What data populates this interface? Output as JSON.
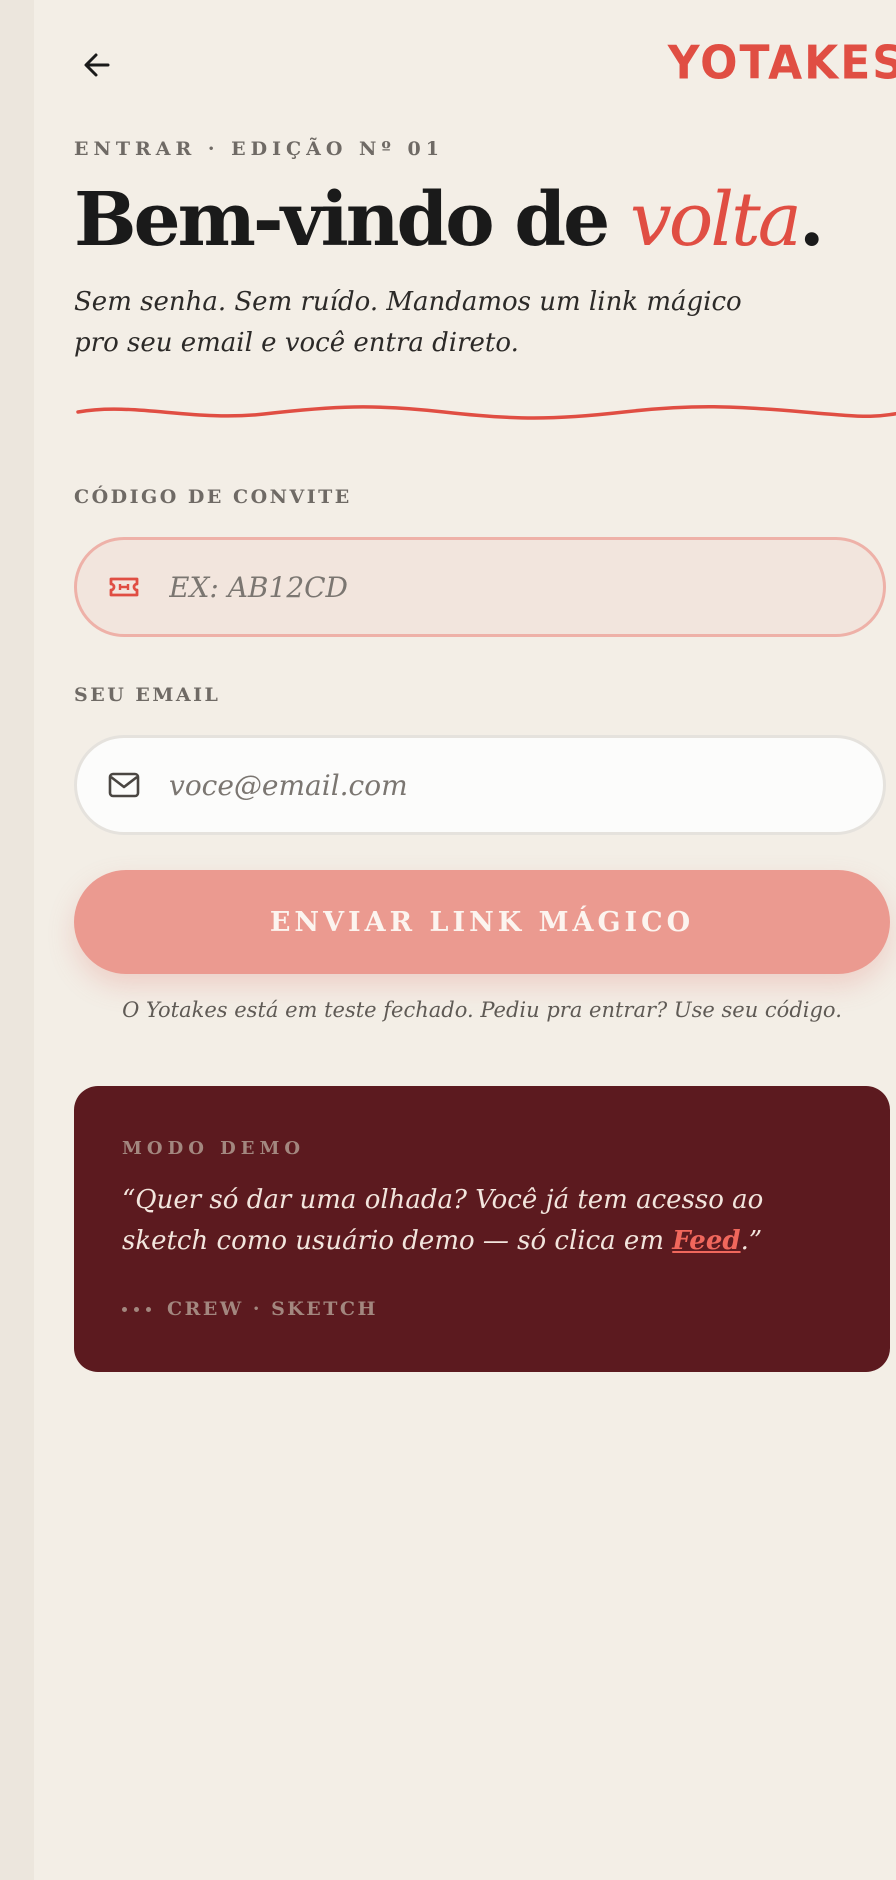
{
  "brand": {
    "logo_text": "YOTAKES",
    "accent_color": "#e04e43"
  },
  "header": {
    "back_icon": "arrow-left-icon"
  },
  "hero": {
    "eyebrow": "ENTRAR · EDIÇÃO Nº 01",
    "headline_prefix": "Bem-vindo de ",
    "headline_accent": "volta",
    "headline_suffix": ".",
    "subtitle": "Sem senha. Sem ruído. Mandamos um link mágico pro seu email e você entra direto."
  },
  "form": {
    "invite": {
      "label": "CÓDIGO DE CONVITE",
      "placeholder": "EX: AB12CD",
      "value": "",
      "icon": "ticket-icon"
    },
    "email": {
      "label": "SEU EMAIL",
      "placeholder": "voce@email.com",
      "value": "",
      "icon": "mail-icon"
    },
    "submit_label": "ENVIAR LINK MÁGICO",
    "submit_color": "#eb9a90",
    "note": "O Yotakes está em teste fechado. Pediu pra entrar? Use seu código."
  },
  "demo": {
    "label": "MODO DEMO",
    "quote_before": "“Quer só dar uma olhada? Você já tem acesso ao sketch como usuário demo — só clica em ",
    "quote_link": "Feed",
    "quote_after": ".”",
    "signature": "CREW · SKETCH",
    "card_color": "#5c1a1f"
  }
}
